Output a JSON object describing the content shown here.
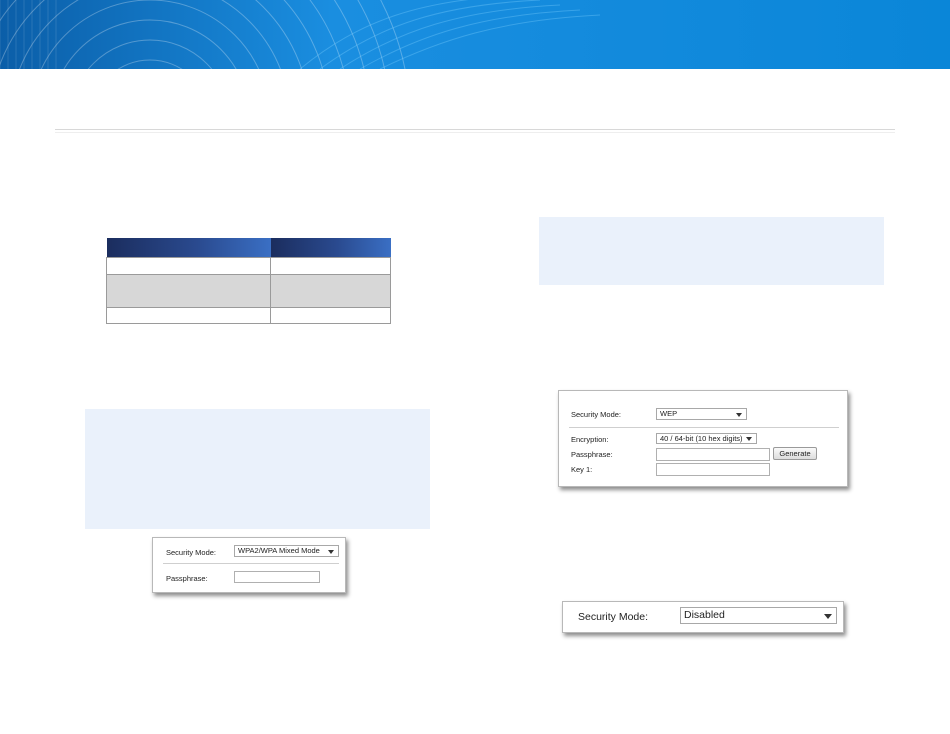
{
  "banner": {
    "colors": {
      "base": "#0a86d8",
      "dark": "#0a63b0",
      "light": "#4fb3ee"
    }
  },
  "spec_table": {
    "header": [
      "",
      ""
    ],
    "rows": [
      [
        "",
        ""
      ],
      [
        "",
        ""
      ],
      [
        "",
        ""
      ]
    ]
  },
  "wpa_panel": {
    "security_mode_label": "Security Mode:",
    "security_mode_value": "WPA2/WPA Mixed Mode",
    "passphrase_label": "Passphrase:",
    "passphrase_value": ""
  },
  "wep_panel": {
    "security_mode_label": "Security Mode:",
    "security_mode_value": "WEP",
    "encryption_label": "Encryption:",
    "encryption_value": "40 / 64-bit (10 hex digits)",
    "passphrase_label": "Passphrase:",
    "passphrase_value": "",
    "generate_label": "Generate",
    "key1_label": "Key 1:",
    "key1_value": ""
  },
  "disabled_panel": {
    "security_mode_label": "Security Mode:",
    "security_mode_value": "Disabled"
  }
}
